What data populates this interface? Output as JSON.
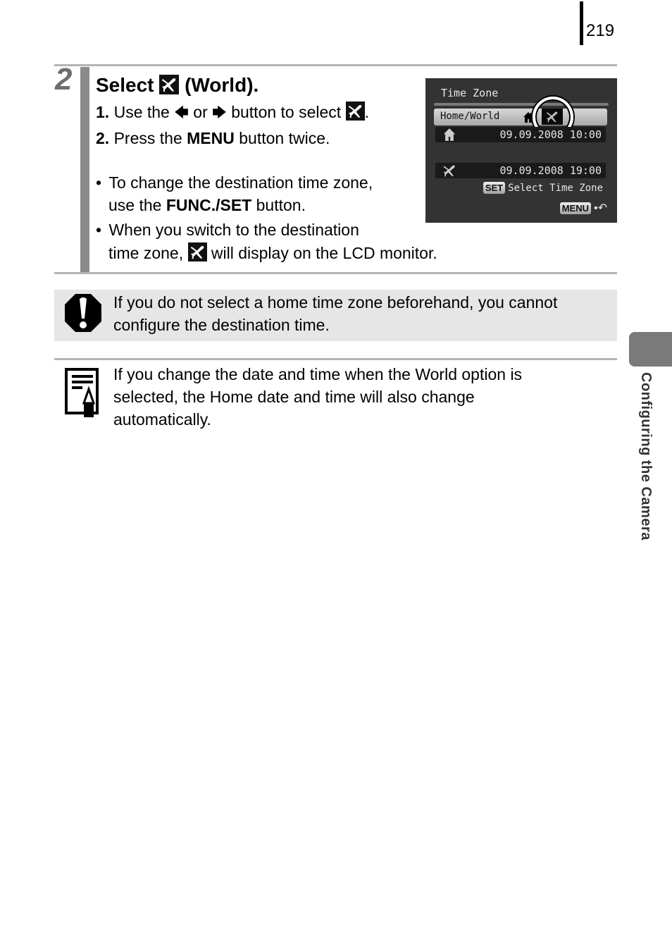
{
  "page_number": "219",
  "step": {
    "number": "2",
    "title_prefix": "Select",
    "title_suffix": "(World).",
    "title_icon": "world-airplane-icon",
    "instructions": [
      {
        "num": "1.",
        "text_a": "Use the",
        "left_arrow": "←",
        "text_or": "or",
        "right_arrow": "→",
        "text_b": "button to select",
        "icon": "world-airplane-icon",
        "text_end": "."
      },
      {
        "num": "2.",
        "text_a": "Press the",
        "bold": "MENU",
        "text_b": "button twice."
      }
    ],
    "bullets": [
      {
        "line1": "To change the destination time zone,",
        "line2_a": "use the",
        "line2_bold": "FUNC./SET",
        "line2_b": "button."
      },
      {
        "line1": "When you switch to the destination",
        "line2_a": "time zone,",
        "line2_icon": "world-airplane-icon",
        "line2_b": "will display on the LCD monitor."
      }
    ],
    "bullet_char": "•"
  },
  "lcd_screen": {
    "title": "Time Zone",
    "selected_row_label": "Home/World",
    "selected_option": "world",
    "home_datetime": "09.09.2008 10:00",
    "world_datetime": "09.09.2008 19:00",
    "set_chip": "SET",
    "set_hint": "Select Time Zone",
    "menu_chip": "MENU",
    "back_symbol": "•↶"
  },
  "caution": {
    "icon": "caution-icon",
    "line1": "If you do not select a home time zone beforehand, you cannot",
    "line2": "configure the destination time."
  },
  "note": {
    "icon": "note-icon",
    "line1": "If you change the date and time when the World option is",
    "line2": "selected, the Home date and time will also change",
    "line3": "automatically."
  },
  "side_tab": {
    "label": "Configuring the Camera"
  },
  "colors": {
    "rule": "#b4b4b4",
    "step_bar": "#8a8a8a",
    "caution_bg": "#e6e6e6",
    "lcd_bg": "#333333",
    "side_tab": "#7a7a7a"
  }
}
